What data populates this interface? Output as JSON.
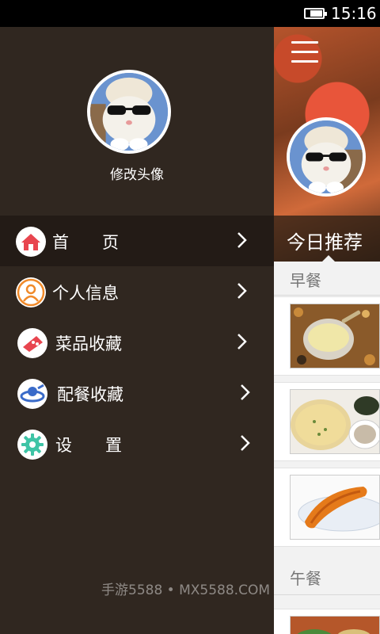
{
  "status_bar": {
    "time": "15:16",
    "battery_level": 0.75
  },
  "drawer": {
    "avatar_caption": "修改头像",
    "items": [
      {
        "label": "首　　页",
        "icon": "home-icon",
        "color": "#e8454f",
        "active": true
      },
      {
        "label": "个人信息",
        "icon": "person-icon",
        "color": "#f08a2a",
        "active": false
      },
      {
        "label": "菜品收藏",
        "icon": "dish-icon",
        "color": "#e8454f",
        "active": false
      },
      {
        "label": "配餐收藏",
        "icon": "meal-icon",
        "color": "#3a6bc9",
        "active": false
      },
      {
        "label": "设　　置",
        "icon": "gear-icon",
        "color": "#3fc4a6",
        "active": false
      }
    ]
  },
  "content": {
    "today_title": "今日推荐",
    "sections": [
      {
        "title": "早餐"
      },
      {
        "title": "午餐"
      }
    ],
    "dishes": [
      {
        "icon": "soy-milk-image"
      },
      {
        "icon": "pancake-image"
      },
      {
        "icon": "fried-dough-image"
      }
    ]
  },
  "watermark": "手游5588 • MX5588.COM",
  "colors": {
    "drawer_bg": "#302720",
    "drawer_active": "#231b16",
    "content_bg": "#f2f2f2"
  }
}
